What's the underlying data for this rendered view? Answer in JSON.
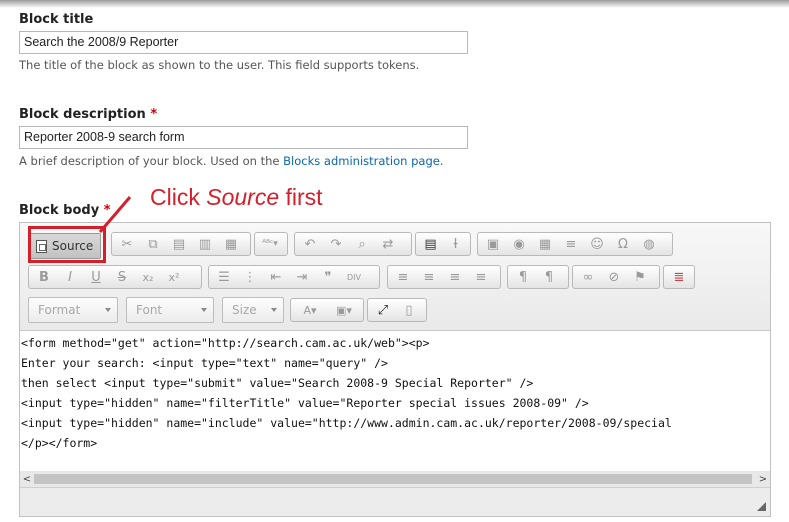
{
  "block_title": {
    "label": "Block title",
    "value": "Search the 2008/9 Reporter",
    "help": "The title of the block as shown to the user. This field supports tokens."
  },
  "block_description": {
    "label": "Block description",
    "required_mark": "*",
    "value": "Reporter 2008-9 search form",
    "help_before": "A brief description of your block. Used on the ",
    "help_link": "Blocks administration page",
    "help_after": "."
  },
  "block_body": {
    "label": "Block body",
    "required_mark": "*"
  },
  "callout": {
    "prefix": "Click ",
    "emphasis": "Source",
    "suffix": " first",
    "color": "#d3202a"
  },
  "editor": {
    "source_label": "Source",
    "format_placeholder": "Format",
    "font_placeholder": "Font",
    "size_placeholder": "Size",
    "lines": [
      "<form method=\"get\" action=\"http://search.cam.ac.uk/web\"><p>",
      "Enter your search: <input type=\"text\" name=\"query\" />",
      "then select <input type=\"submit\" value=\"Search 2008-9 Special Reporter\" />",
      "<input type=\"hidden\" name=\"filterTitle\" value=\"Reporter special issues 2008-09\" />",
      "<input type=\"hidden\" name=\"include\" value=\"http://www.admin.cam.ac.uk/reporter/2008-09/special",
      "</p></form>"
    ]
  },
  "colors": {
    "link": "#0a66b0",
    "required": "#c00000",
    "highlight": "#d3202a"
  }
}
